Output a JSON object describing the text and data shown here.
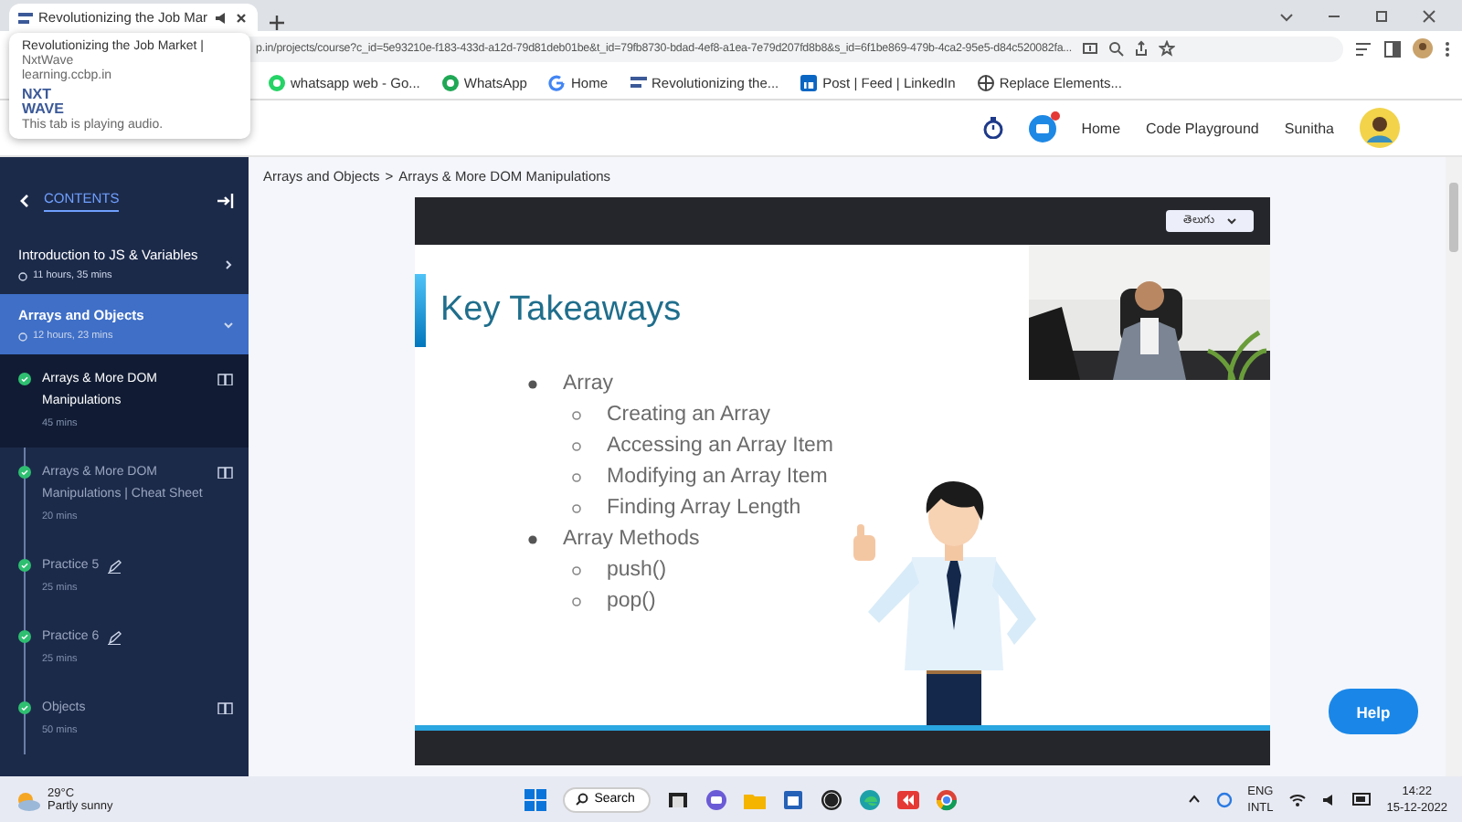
{
  "browser": {
    "tabs": [
      {
        "title": "Revolutionizing the Job Mar",
        "selected": true,
        "audio": true
      }
    ],
    "hover_card": {
      "title": "Revolutionizing the Job Market |",
      "site": "NxtWave",
      "domain": "learning.ccbp.in",
      "logo_top": "NXT",
      "logo_bottom": "WAVE",
      "note": "This tab is playing audio."
    },
    "address": "p.in/projects/course?c_id=5e93210e-f183-433d-a12d-79d81deb01be&t_id=79fb8730-bdad-4ef8-a1ea-7e79d207fd8b8&s_id=6f1be869-479b-4ca2-95e5-d84c520082fa...",
    "bookmarks": [
      {
        "label": "whatsapp web - Go...",
        "kind": "whatsapp"
      },
      {
        "label": "WhatsApp",
        "kind": "whatsapp-green"
      },
      {
        "label": "Home",
        "kind": "google"
      },
      {
        "label": "Revolutionizing the...",
        "kind": "nxt"
      },
      {
        "label": "Post | Feed | LinkedIn",
        "kind": "linkedin"
      },
      {
        "label": "Replace Elements...",
        "kind": "globe"
      }
    ]
  },
  "header": {
    "nav": [
      "Home",
      "Code Playground"
    ],
    "user": "Sunitha",
    "notification": true
  },
  "sidebar": {
    "title": "CONTENTS",
    "modules": [
      {
        "title": "Introduction to JS & Variables",
        "duration": "11 hours, 35 mins",
        "expanded": false,
        "selected": false
      },
      {
        "title": "Arrays and Objects",
        "duration": "12 hours, 23 mins",
        "expanded": true,
        "selected": true,
        "children": [
          {
            "title": "Arrays & More DOM Manipulations",
            "duration": "45 mins",
            "kind": "reading",
            "completed": true,
            "selected": true
          },
          {
            "title": "Arrays & More DOM Manipulations | Cheat Sheet",
            "duration": "20 mins",
            "kind": "reading",
            "completed": true,
            "selected": false
          },
          {
            "title": "Practice 5",
            "duration": "25 mins",
            "kind": "practice",
            "completed": true,
            "selected": false
          },
          {
            "title": "Practice 6",
            "duration": "25 mins",
            "kind": "practice",
            "completed": true,
            "selected": false
          },
          {
            "title": "Objects",
            "duration": "50 mins",
            "kind": "reading",
            "completed": true,
            "selected": false
          }
        ]
      }
    ]
  },
  "breadcrumb": {
    "items": [
      "Arrays and Objects",
      "Arrays & More DOM Manipulations"
    ],
    "separator": ">"
  },
  "video": {
    "language": "తెలుగు",
    "slide_title": "Key Takeaways",
    "bullets": [
      {
        "text": "Array",
        "children": [
          {
            "text": "Creating an Array"
          },
          {
            "text": "Accessing an Array Item"
          },
          {
            "text": "Modifying an Array Item"
          },
          {
            "text": "Finding Array Length"
          }
        ]
      },
      {
        "text": "Array Methods",
        "children": [
          {
            "text": "push()"
          },
          {
            "text": "pop()"
          }
        ]
      }
    ]
  },
  "help_button": "Help",
  "taskbar": {
    "temperature": "29°C",
    "weather": "Partly sunny",
    "search": "Search",
    "language": "ENG",
    "layout": "INTL",
    "time": "14:22",
    "date": "15-12-2022"
  }
}
